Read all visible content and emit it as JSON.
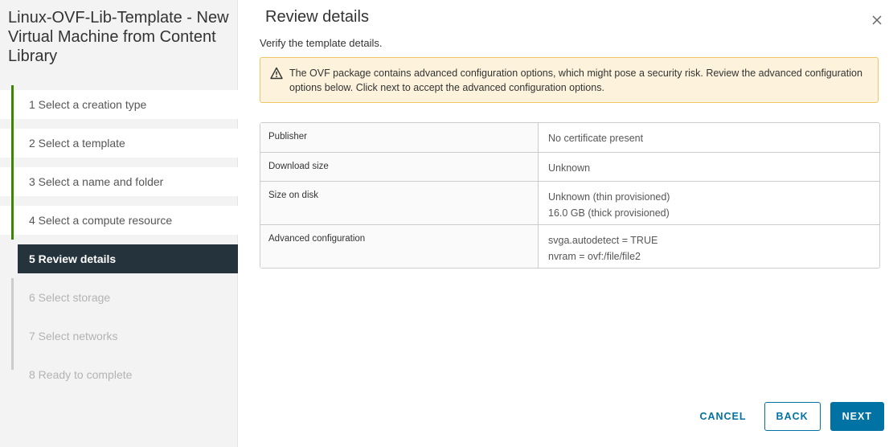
{
  "wizard": {
    "title": "Linux-OVF-Lib-Template - New Virtual Machine from Content Library",
    "steps": [
      {
        "label": "1  Select a creation type",
        "state": "completed"
      },
      {
        "label": "2  Select a template",
        "state": "completed"
      },
      {
        "label": "3  Select a name and folder",
        "state": "completed"
      },
      {
        "label": "4  Select a compute resource",
        "state": "completed"
      },
      {
        "label": "5  Review details",
        "state": "current"
      },
      {
        "label": "6  Select storage",
        "state": "pending"
      },
      {
        "label": "7  Select networks",
        "state": "pending"
      },
      {
        "label": "8  Ready to complete",
        "state": "pending"
      }
    ]
  },
  "page": {
    "title": "Review details",
    "subtitle": "Verify the template details.",
    "close_icon": "close-icon"
  },
  "alert": {
    "icon": "warning-icon",
    "text": "The OVF package contains advanced configuration options, which might pose a security risk. Review the advanced configuration options below. Click next to accept the advanced configuration options."
  },
  "details": [
    {
      "key": "Publisher",
      "values": [
        "No certificate present"
      ]
    },
    {
      "key": "Download size",
      "values": [
        "Unknown"
      ]
    },
    {
      "key": "Size on disk",
      "values": [
        "Unknown (thin provisioned)",
        "16.0 GB (thick provisioned)"
      ]
    },
    {
      "key": "Advanced configuration",
      "values": [
        "svga.autodetect = TRUE",
        "nvram = ovf:/file/file2"
      ]
    }
  ],
  "footer": {
    "cancel_label": "CANCEL",
    "back_label": "BACK",
    "next_label": "NEXT"
  },
  "colors": {
    "accent": "#0072a3",
    "completed": "#3c8500",
    "current_bg": "#25333d",
    "warning_bg": "#fdf3dd",
    "warning_border": "#efc663"
  }
}
